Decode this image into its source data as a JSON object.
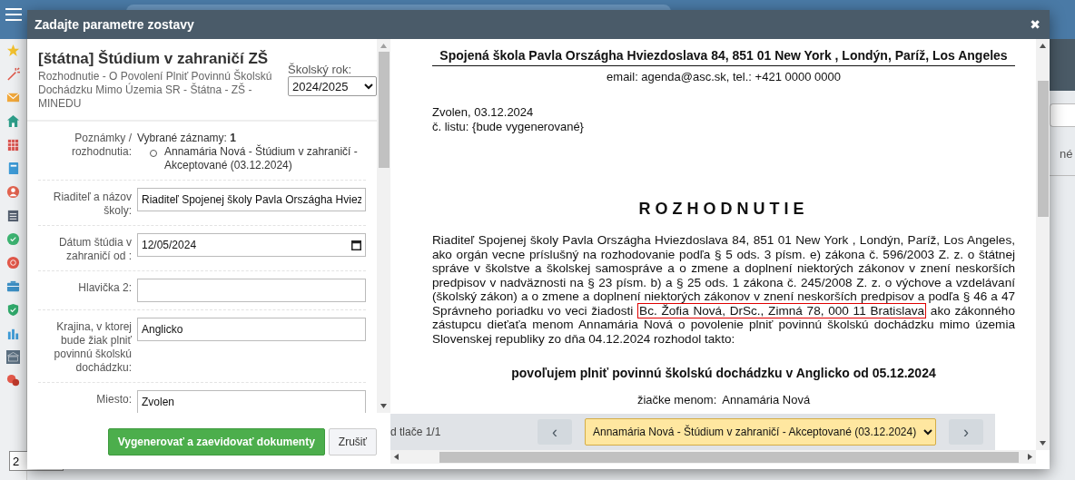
{
  "background": {
    "sidebar_field": "2",
    "fragment": "né"
  },
  "dialog": {
    "title": "Zadajte parametre zostavy",
    "close": "✖"
  },
  "report": {
    "title": "[štátna] Štúdium v zahraničí ZŠ",
    "subtitle": "Rozhodnutie - O Povolení Plniť Povinnú Školskú Dochádzku Mimo Územia SR - Štátna - ZŠ - MINEDU",
    "year_label": "Školský rok:",
    "year_value": "2024/2025"
  },
  "form": {
    "notes": {
      "label": "Poznámky / rozhodnutia:",
      "summary": "Vybrané záznamy: **1**",
      "items": [
        "Annamária Nová - Štúdium v zahraničí - Akceptované (03.12.2024)"
      ]
    },
    "fields": [
      {
        "kind": "text",
        "label": "Riaditeľ a názov školy:",
        "value": "Riaditeľ Spojenej školy Pavla Országha Hviez"
      },
      {
        "kind": "date",
        "label": "Dátum štúdia v zahraničí od :",
        "value": "12/05/2024"
      },
      {
        "kind": "text",
        "label": "Hlavička 2:"
      },
      {
        "kind": "text",
        "label": "Krajina, v ktorej bude žiak plniť povinnú školskú dochádzku:",
        "value": "Anglicko"
      },
      {
        "kind": "text",
        "label": "Miesto:",
        "value": "Zvolen"
      }
    ]
  },
  "buttons": [
    {
      "kind": "primary",
      "label": "Vygenerovať a zaevidovať dokumenty"
    },
    {
      "kind": "secondary",
      "label": "Zrušiť"
    }
  ],
  "document": {
    "school": "Spojená škola Pavla Országha Hviezdoslava 84, 851 01 New York , Londýn, Paríž, Los Angeles",
    "contact": "email: agenda@asc.sk, tel.: +421 0000 0000",
    "place_date": "Zvolen, 03.12.2024",
    "letter_no": "č. listu: {bude vygenerované}",
    "heading": "ROZHODNUTIE",
    "body_before": "Riaditeľ Spojenej školy Pavla Országha Hviezdoslava 84, 851 01 New York , Londýn, Paríž, Los Angeles, ako orgán vecne príslušný na rozhodovanie podľa § 5 ods. 3 písm. e) zákona č. 596/2003 Z. z. o štátnej správe v školstve a školskej samospráve a o zmene a doplnení niektorých zákonov v znení neskorších predpisov v nadväznosti na § 23 písm. b) a § 25 ods. 1 zákona č. 245/2008 Z. z. o výchove a vzdelávaní (školský zákon) a o zmene a doplnení niektorých zákonov v znení neskorších predpisov a podľa § 46 a 47 Správneho poriadku vo veci žiadosti",
    "body_highlight": "Bc. Žofia Nová, DrSc., Zimná 78, 000 11 Bratislava",
    "body_after": "ako zákonného zástupcu dieťaťa menom Annamária Nová o povolenie plniť povinnú školskú dochádzku mimo územia Slovenskej republiky zo dňa 04.12.2024 rozhodol takto:",
    "decision": "povoľujem plniť povinnú školskú dochádzku v Anglicko od 05.12.2024",
    "pupil_label": "žiačke menom:",
    "pupil_name": "Annamária Nová"
  },
  "print_bar": {
    "page_info": "d tlače 1/1",
    "prev": "‹",
    "record": "Annamária Nová - Štúdium v zahraničí - Akceptované (03.12.2024)",
    "next": "›"
  }
}
